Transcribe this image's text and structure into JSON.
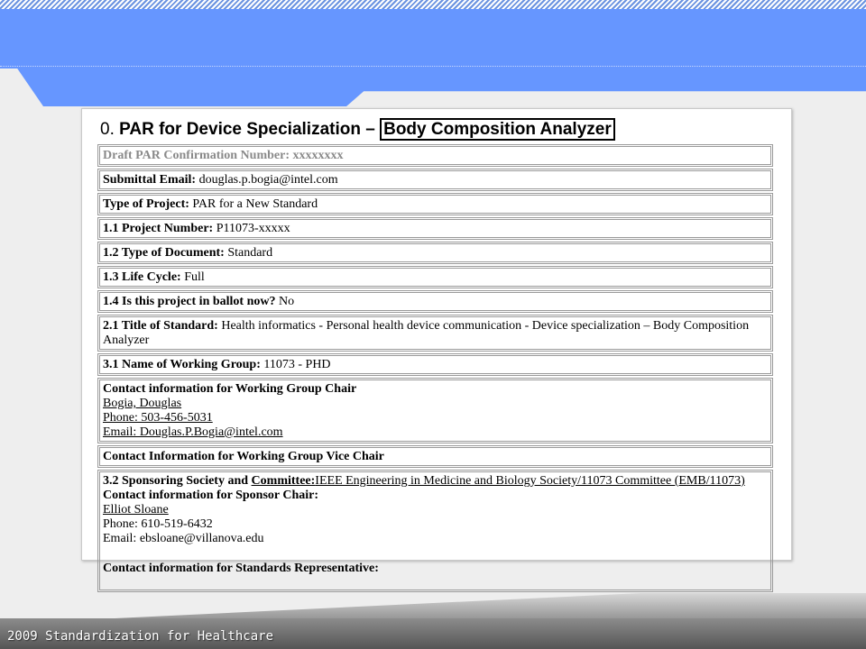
{
  "title": {
    "prefix": "0. ",
    "main": "PAR for Device Specialization – ",
    "highlight": "Body Composition Analyzer"
  },
  "rows": {
    "confirmation": {
      "label": "Draft PAR Confirmation Number: ",
      "value": "xxxxxxxx"
    },
    "email": {
      "label": "Submittal Email: ",
      "value": "douglas.p.bogia@intel.com"
    },
    "type_project": {
      "label": "Type of Project: ",
      "value": "PAR for a New Standard"
    },
    "project_number": {
      "label": "1.1 Project Number: ",
      "value": "P11073-xxxxx"
    },
    "type_document": {
      "label": "1.2 Type of Document: ",
      "value": "Standard"
    },
    "life_cycle": {
      "label": "1.3 Life Cycle: ",
      "value": "Full"
    },
    "ballot": {
      "label": "1.4 Is this project in ballot now? ",
      "value": "No"
    },
    "title_standard": {
      "label": "2.1 Title of Standard: ",
      "value": "Health informatics - Personal health device communication - Device specialization – Body Composition Analyzer"
    },
    "working_group": {
      "label": "3.1 Name of Working Group: ",
      "value": "11073 - PHD"
    },
    "wg_chair": {
      "label": "Contact information for Working Group Chair",
      "name": "Bogia, Douglas",
      "phone": "Phone:  503-456-5031",
      "email": "Email:  Douglas.P.Bogia@intel.com"
    },
    "wg_vice_chair": {
      "label": "Contact Information for Working Group Vice Chair"
    },
    "sponsoring": {
      "label_a": "3.2 Sponsoring Society and ",
      "label_b": "Committee:",
      "value": "IEEE Engineering in Medicine and Biology Society/11073 Committee (EMB/11073)",
      "sponsor_chair_label": "Contact information for Sponsor Chair:",
      "name": "Elliot Sloane",
      "phone": "Phone: 610-519-6432",
      "email": "Email: ebsloane@villanova.edu",
      "standards_rep_label": "Contact information for Standards Representative:"
    }
  },
  "footer": {
    "text": "2009 Standardization for Healthcare"
  },
  "colors": {
    "header_blue": "#6696ff",
    "footer_grey": "#5f5f5f"
  }
}
